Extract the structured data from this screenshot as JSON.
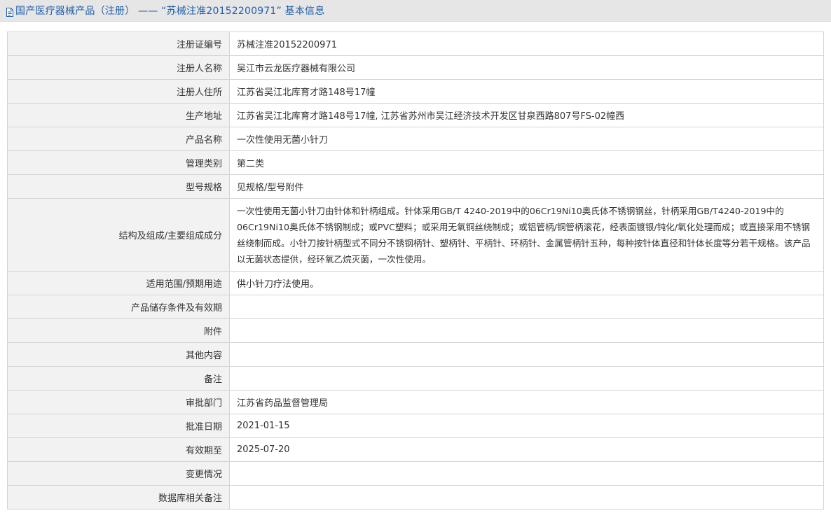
{
  "header": {
    "icon": "document-icon",
    "title": "国产医疗器械产品（注册） —— “苏械注准20152200971” 基本信息"
  },
  "rows": [
    {
      "label": "注册证编号",
      "value": "苏械注准20152200971"
    },
    {
      "label": "注册人名称",
      "value": "吴江市云龙医疗器械有限公司"
    },
    {
      "label": "注册人住所",
      "value": "江苏省吴江北库育才路148号17幢"
    },
    {
      "label": "生产地址",
      "value": "江苏省吴江北库育才路148号17幢, 江苏省苏州市吴江经济技术开发区甘泉西路807号FS-02幢西"
    },
    {
      "label": "产品名称",
      "value": "一次性使用无菌小针刀"
    },
    {
      "label": "管理类别",
      "value": "第二类"
    },
    {
      "label": "型号规格",
      "value": "见规格/型号附件"
    },
    {
      "label": "结构及组成/主要组成成分",
      "value": "一次性使用无菌小针刀由针体和针柄组成。针体采用GB/T 4240-2019中的06Cr19Ni10奥氏体不锈钢钢丝，针柄采用GB/T4240-2019中的06Cr19Ni10奥氏体不锈钢制成；或PVC塑料；或采用无氧铜丝绕制成；或铝管柄/铜管柄滚花，经表面镀银/钝化/氧化处理而成；或直接采用不锈钢丝绕制而成。小针刀按针柄型式不同分不锈钢柄针、塑柄针、平柄针、环柄针、金属管柄针五种，每种按针体直径和针体长度等分若干规格。该产品以无菌状态提供，经环氧乙烷灭菌，一次性使用。"
    },
    {
      "label": "适用范围/预期用途",
      "value": "供小针刀疗法使用。"
    },
    {
      "label": "产品储存条件及有效期",
      "value": ""
    },
    {
      "label": "附件",
      "value": ""
    },
    {
      "label": "其他内容",
      "value": ""
    },
    {
      "label": "备注",
      "value": ""
    },
    {
      "label": "审批部门",
      "value": "江苏省药品监督管理局"
    },
    {
      "label": "批准日期",
      "value": "2021-01-15"
    },
    {
      "label": "有效期至",
      "value": "2025-07-20"
    },
    {
      "label": "变更情况",
      "value": ""
    },
    {
      "label": "数据库相关备注",
      "value": ""
    }
  ]
}
